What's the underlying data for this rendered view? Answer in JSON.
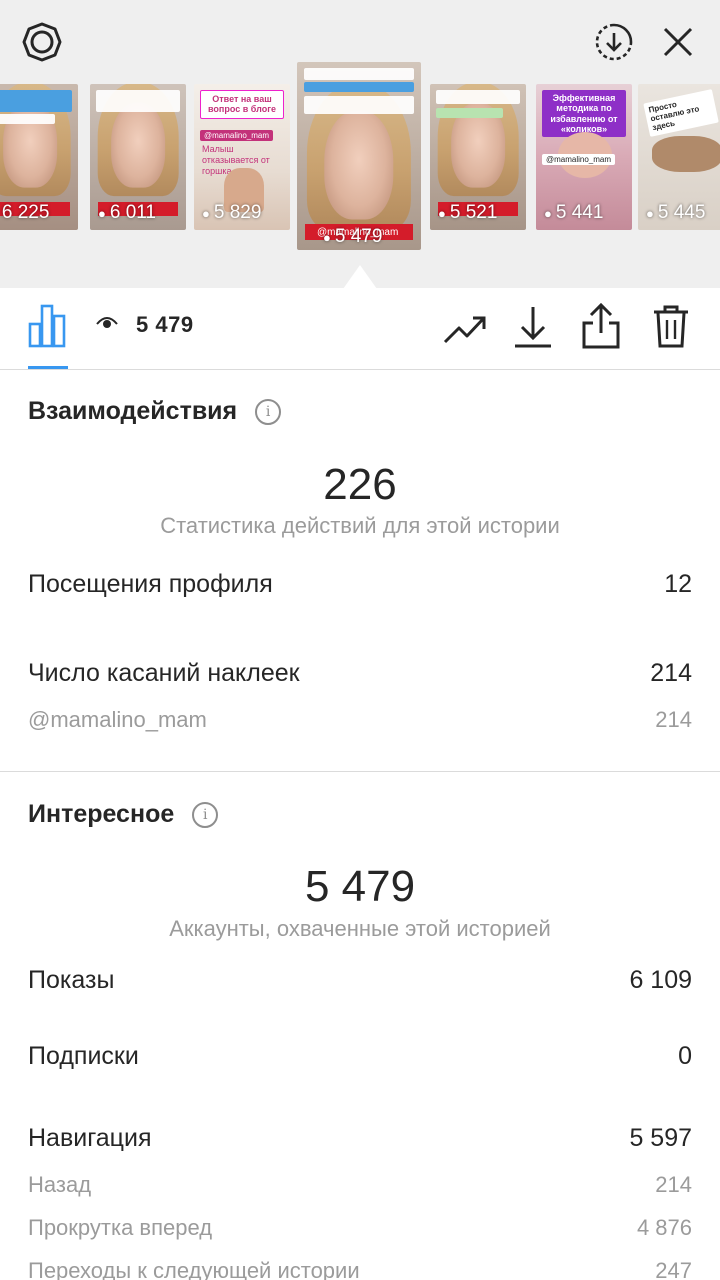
{
  "top": {
    "icons": [
      "settings-icon",
      "save-icon",
      "close-icon"
    ],
    "thumbnails": [
      {
        "views": "6 225",
        "style": "face",
        "caption": true
      },
      {
        "views": "6 011",
        "style": "face",
        "caption": true
      },
      {
        "views": "5 829",
        "style": "baby",
        "banner": "Ответ на ваш вопрос в блоге",
        "tag": "@mamalino_mam",
        "subtext": "Малыш отказывается от горшка"
      },
      {
        "views": "5 479",
        "style": "face",
        "caption": true,
        "active": true,
        "handle": "@mamalino_mam"
      },
      {
        "views": "5 521",
        "style": "face",
        "caption": true
      },
      {
        "views": "5 441",
        "style": "baby2",
        "banner": "Эффективная методика по избавлению от «коликов»",
        "tag": "@mamalino_mam"
      },
      {
        "views": "5 445",
        "style": "cat",
        "banner": "Просто оставлю это здесь"
      }
    ]
  },
  "toolbar": {
    "views": "5 479",
    "accent": "#3897f0"
  },
  "interactions": {
    "title": "Взаимодействия",
    "total": "226",
    "total_label": "Статистика действий для этой истории",
    "rows": [
      {
        "label": "Посещения профиля",
        "value": "12"
      },
      {
        "label": "Число касаний наклеек",
        "value": "214"
      }
    ],
    "sub_rows": [
      {
        "label": "@mamalino_mam",
        "value": "214"
      }
    ]
  },
  "discovery": {
    "title": "Интересное",
    "total": "5 479",
    "total_label": "Аккаунты, охваченные этой историей",
    "rows": [
      {
        "label": "Показы",
        "value": "6 109"
      },
      {
        "label": "Подписки",
        "value": "0"
      },
      {
        "label": "Навигация",
        "value": "5 597"
      }
    ],
    "sub_rows": [
      {
        "label": "Назад",
        "value": "214"
      },
      {
        "label": "Прокрутка вперед",
        "value": "4 876"
      },
      {
        "label": "Переходы к следующей истории",
        "value": "247"
      }
    ]
  }
}
